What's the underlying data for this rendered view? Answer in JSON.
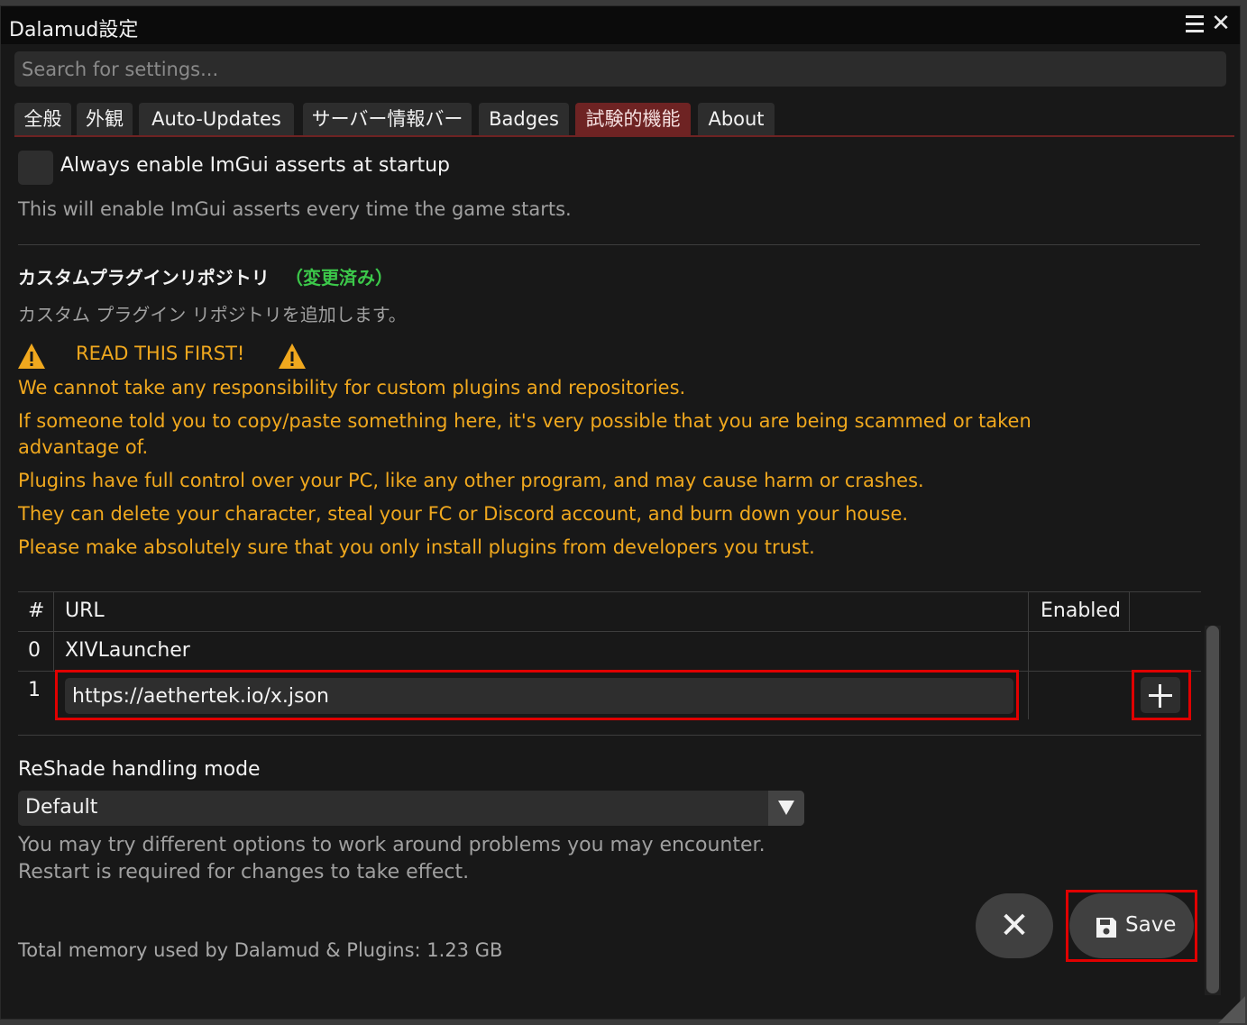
{
  "window": {
    "title": "Dalamud設定"
  },
  "search": {
    "placeholder": "Search for settings..."
  },
  "tabs": [
    {
      "label": "全般",
      "active": false
    },
    {
      "label": "外観",
      "active": false
    },
    {
      "label": "Auto-Updates",
      "active": false
    },
    {
      "label": "サーバー情報バー",
      "active": false
    },
    {
      "label": "Badges",
      "active": false
    },
    {
      "label": "試験的機能",
      "active": true
    },
    {
      "label": "About",
      "active": false
    }
  ],
  "imgui": {
    "checkbox_label": "Always enable ImGui asserts at startup",
    "checked": false,
    "hint": "This will enable ImGui asserts every time the game starts."
  },
  "repo": {
    "title": "カスタムプラグインリポジトリ",
    "modified": "（変更済み）",
    "hint": "カスタム プラグイン リポジトリを追加します。",
    "warning_title": "READ THIS FIRST!",
    "warnings": [
      "We cannot take any responsibility for custom plugins and repositories.",
      "If someone told you to copy/paste something here, it's very possible that you are being scammed or taken",
      "advantage of.",
      "Plugins have full control over your PC, like any other program, and may cause harm or crashes.",
      "They can delete your character, steal your FC or Discord account, and burn down your house.",
      "Please make absolutely sure that you only install plugins from developers you trust."
    ],
    "table": {
      "col_index": "#",
      "col_url": "URL",
      "col_enabled": "Enabled",
      "rows": [
        {
          "index": "0",
          "url": "XIVLauncher"
        }
      ],
      "new_row_index": "1",
      "new_url_value": "https://aethertek.io/x.json"
    }
  },
  "reshade": {
    "label": "ReShade handling mode",
    "selected": "Default",
    "hint_line1": "You may try different options to work around problems you may encounter.",
    "hint_line2": "Restart is required for changes to take effect."
  },
  "footer": {
    "memory": "Total memory used by Dalamud & Plugins: 1.23 GB",
    "save_label": "Save"
  },
  "colors": {
    "accent": "#6e2323",
    "warning": "#f0a81e",
    "modified": "#3cc84a",
    "highlight_box": "#e00000"
  }
}
